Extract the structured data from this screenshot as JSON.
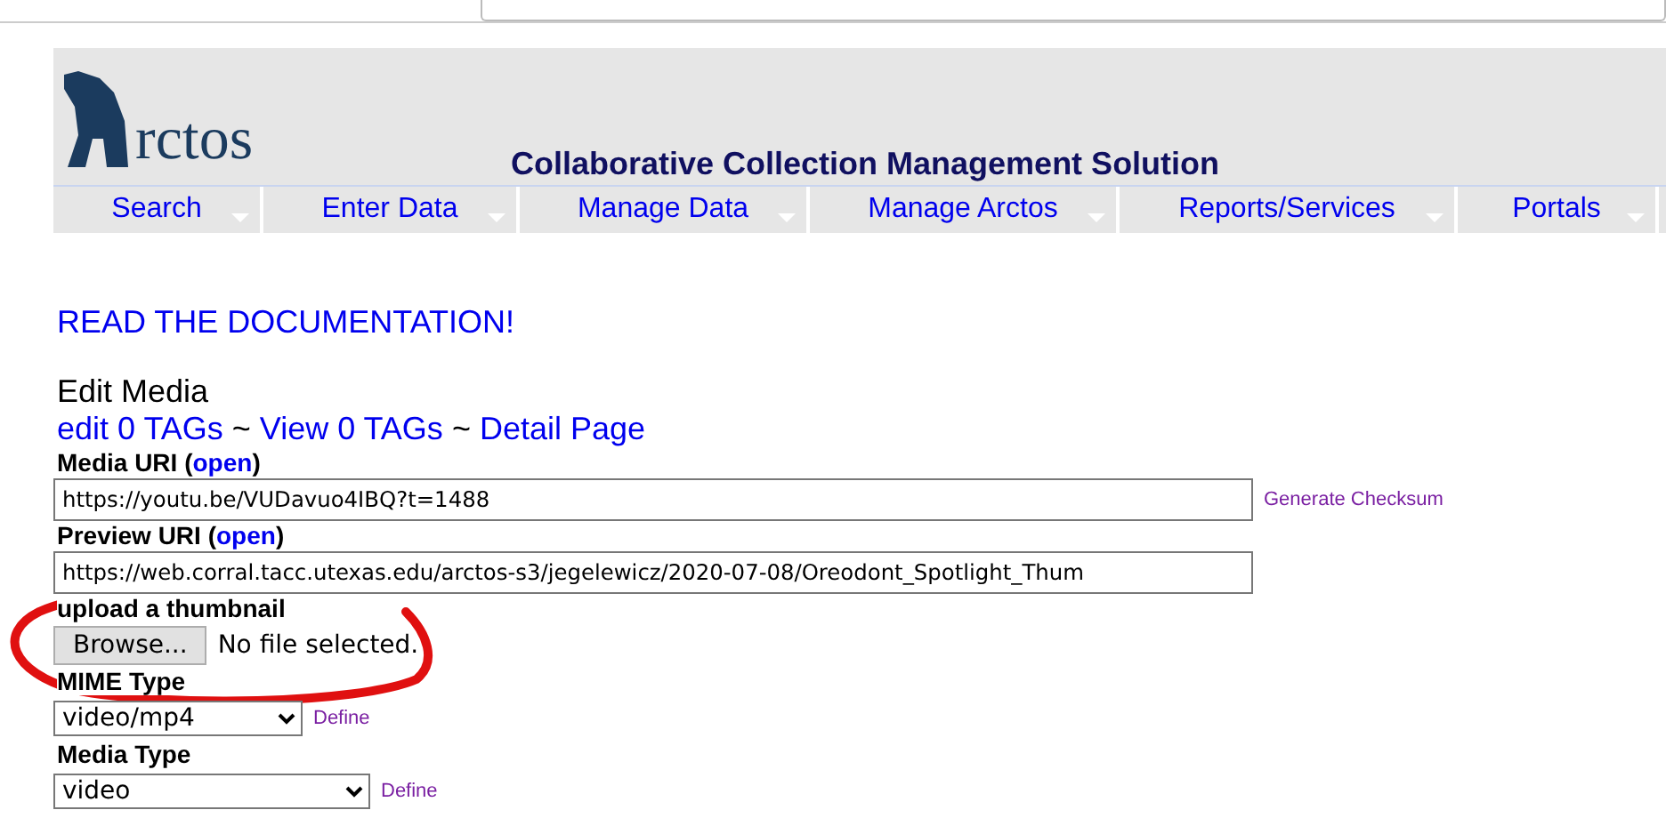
{
  "header": {
    "logo_text": "rctos",
    "title": "Collaborative Collection Management Solution"
  },
  "nav": [
    {
      "label": "Search"
    },
    {
      "label": "Enter Data"
    },
    {
      "label": "Manage Data"
    },
    {
      "label": "Manage Arctos"
    },
    {
      "label": "Reports/Services"
    },
    {
      "label": "Portals"
    }
  ],
  "doc_link": "READ THE DOCUMENTATION!",
  "page_title": "Edit Media",
  "tag_links": [
    {
      "label": "edit 0 TAGs"
    },
    {
      "label": "View 0 TAGs"
    },
    {
      "label": "Detail Page"
    }
  ],
  "separator": "~",
  "media_uri": {
    "label": "Media URI (",
    "link": "open",
    "label_end": ")",
    "value": "https://youtu.be/VUDavuo4IBQ?t=1488",
    "action": "Generate Checksum"
  },
  "preview_uri": {
    "label": "Preview URI (",
    "link": "open",
    "label_end": ")",
    "value": "https://web.corral.tacc.utexas.edu/arctos-s3/jegelewicz/2020-07-08/Oreodont_Spotlight_Thum"
  },
  "thumbnail": {
    "label": "upload a thumbnail",
    "button": "Browse...",
    "status": "No file selected."
  },
  "mime_type": {
    "label": "MIME Type",
    "value": "video/mp4",
    "action": "Define"
  },
  "media_type": {
    "label": "Media Type",
    "value": "video",
    "action": "Define"
  }
}
